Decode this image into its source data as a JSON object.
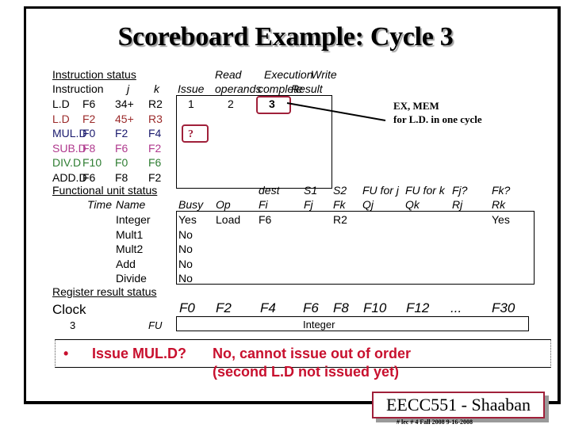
{
  "title": "Scoreboard Example:  Cycle 3",
  "instruction_status": {
    "heading": "Instruction status",
    "headers": {
      "instruction": "Instruction",
      "j": "j",
      "k": "k",
      "issue": "Issue",
      "read_1": "Read",
      "read_2": "operands",
      "exec_1": "Execution",
      "exec_2": "complete",
      "write_1": "Write",
      "write_2": "Result"
    },
    "rows": [
      {
        "op": "L.D",
        "dest": "F6",
        "j": "34+",
        "k": "R2",
        "issue": "1",
        "read": "2",
        "exec": "3",
        "write": "",
        "color": "#000000"
      },
      {
        "op": "L.D",
        "dest": "F2",
        "j": "45+",
        "k": "R3",
        "issue": "",
        "read": "",
        "exec": "",
        "write": "",
        "color": "#9b2a2a"
      },
      {
        "op": "MUL.D",
        "dest": "F0",
        "j": "F2",
        "k": "F4",
        "issue": "?",
        "read": "",
        "exec": "",
        "write": "",
        "color": "#1a1a6e"
      },
      {
        "op": "SUB.D",
        "dest": "F8",
        "j": "F6",
        "k": "F2",
        "issue": "",
        "read": "",
        "exec": "",
        "write": "",
        "color": "#b03a8e"
      },
      {
        "op": "DIV.D",
        "dest": "F10",
        "j": "F0",
        "k": "F6",
        "issue": "",
        "read": "",
        "exec": "",
        "write": "",
        "color": "#2e7d32"
      },
      {
        "op": "ADD.D",
        "dest": "F6",
        "j": "F8",
        "k": "F2",
        "issue": "",
        "read": "",
        "exec": "",
        "write": "",
        "color": "#000000"
      }
    ]
  },
  "annotation": {
    "line1": "EX, MEM",
    "line2": "for L.D. in one cycle"
  },
  "functional_unit_status": {
    "heading": "Functional unit status",
    "headers_top": {
      "dest": "dest",
      "s1": "S1",
      "s2": "S2",
      "fuj": "FU for j",
      "fuk": "FU for k",
      "fjq": "Fj?",
      "fkq": "Fk?"
    },
    "headers": {
      "time": "Time",
      "name": "Name",
      "busy": "Busy",
      "op": "Op",
      "fi": "Fi",
      "fj": "Fj",
      "fk": "Fk",
      "qj": "Qj",
      "qk": "Qk",
      "rj": "Rj",
      "rk": "Rk"
    },
    "rows": [
      {
        "name": "Integer",
        "busy": "Yes",
        "op": "Load",
        "fi": "F6",
        "fj": "",
        "fk": "R2",
        "qj": "",
        "qk": "",
        "rj": "",
        "rk": "Yes"
      },
      {
        "name": "Mult1",
        "busy": "No",
        "op": "",
        "fi": "",
        "fj": "",
        "fk": "",
        "qj": "",
        "qk": "",
        "rj": "",
        "rk": ""
      },
      {
        "name": "Mult2",
        "busy": "No",
        "op": "",
        "fi": "",
        "fj": "",
        "fk": "",
        "qj": "",
        "qk": "",
        "rj": "",
        "rk": ""
      },
      {
        "name": "Add",
        "busy": "No",
        "op": "",
        "fi": "",
        "fj": "",
        "fk": "",
        "qj": "",
        "qk": "",
        "rj": "",
        "rk": ""
      },
      {
        "name": "Divide",
        "busy": "No",
        "op": "",
        "fi": "",
        "fj": "",
        "fk": "",
        "qj": "",
        "qk": "",
        "rj": "",
        "rk": ""
      }
    ]
  },
  "register_result_status": {
    "heading": "Register result status",
    "clock_label": "Clock",
    "clock_value": "3",
    "fu_label": "FU",
    "registers": [
      "F0",
      "F2",
      "F4",
      "F6",
      "F8",
      "F10",
      "F12",
      "...",
      "F30"
    ],
    "values": [
      "",
      "",
      "",
      "Integer",
      "",
      "",
      "",
      "",
      ""
    ]
  },
  "bullet": {
    "symbol": "•",
    "question": "Issue MUL.D?",
    "answer_line1": "No, cannot issue out of order",
    "answer_line2": "(second L.D not issued yet)"
  },
  "badge": "EECC551 - Shaaban",
  "footer": "#  lec # 4  Fall 2008     9-16-2008"
}
